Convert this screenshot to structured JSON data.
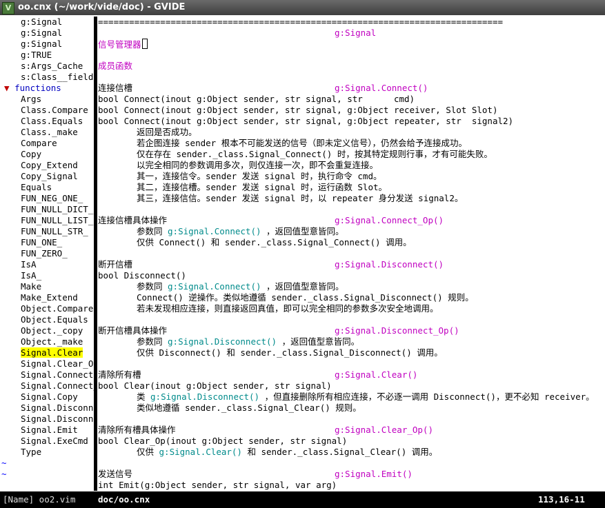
{
  "window": {
    "title": "oo.cnx (~/work/vide/doc) - GVIDE",
    "icon": "vim-icon"
  },
  "tree": {
    "top_items": [
      "g:Signal",
      "g:Signal",
      "g:Signal",
      "g:TRUE",
      "s:Args_Cache",
      "s:Class__field"
    ],
    "folder": {
      "arrow": "▼",
      "label": "functions"
    },
    "items": [
      "Args",
      "Class.Compare",
      "Class.Equals",
      "Class._make",
      "Compare",
      "Copy",
      "Copy_Extend",
      "Copy_Signal",
      "Equals",
      "FUN_NEG_ONE_",
      "FUN_NULL_DICT_",
      "FUN_NULL_LIST_",
      "FUN_NULL_STR_",
      "FUN_ONE_",
      "FUN_ZERO_",
      "IsA",
      "IsA_",
      "Make",
      "Make_Extend",
      "Object.Compare",
      "Object.Equals",
      "Object._copy",
      "Object._make",
      "Signal.Clear",
      "Signal.Clear_Op",
      "Signal.Connect",
      "Signal.Connect_",
      "Signal.Copy",
      "Signal.Disconne",
      "Signal.Disconne",
      "Signal.Emit",
      "Signal.ExeCmd",
      "Type"
    ],
    "selected": "Signal.Clear",
    "tildes": [
      "~",
      "~"
    ]
  },
  "doc": {
    "rule": "==============================================================================",
    "signal_tag": "g:Signal",
    "title": "信号管理器",
    "members": "成员函数",
    "sections": [
      {
        "heading": "连接信槽",
        "tag": "g:Signal.Connect()",
        "code": [
          "bool Connect(inout g:Object sender, str signal, str      cmd)",
          "bool Connect(inout g:Object sender, str signal, g:Object receiver, Slot Slot)",
          "bool Connect(inout g:Object sender, str signal, g:Object repeater, str  signal2)"
        ],
        "desc": [
          "返回是否成功。",
          "若企图连接 sender 根本不可能发送的信号（即未定义信号），仍然会给予连接成功。",
          "仅在存在 sender._class.Signal_Connect() 时，按其特定规则行事，才有可能失败。",
          "以完全相同的参数调用多次，则仅连接一次，即不会重复连接。",
          "其一，连接信令。sender 发送 signal 时，执行命令 cmd。",
          "其二，连接信槽。sender 发送 signal 时，运行函数 Slot。",
          "其三，连接信信。sender 发送 signal 时，以 repeater 身分发送 signal2。"
        ]
      },
      {
        "heading": "连接信槽具体操作",
        "tag": "g:Signal.Connect_Op()",
        "l1": {
          "pre": "参数同 ",
          "link": "g:Signal.Connect()",
          "post": " ，返回值型意皆同。"
        },
        "l2": "仅供 Connect() 和 sender._class.Signal_Connect() 调用。"
      },
      {
        "heading": "断开信槽",
        "tag": "g:Signal.Disconnect()",
        "code": "bool Disconnect()",
        "l1": {
          "pre": "参数同 ",
          "link": "g:Signal.Connect()",
          "post": " ，返回值型意皆同。"
        },
        "l2": "Connect() 逆操作。类似地遵循 sender._class.Signal_Disconnect() 规则。",
        "l3": "若未发现相应连接，则直接返回真值，即可以完全相同的参数多次安全地调用。"
      },
      {
        "heading": "断开信槽具体操作",
        "tag": "g:Signal.Disconnect_Op()",
        "l1": {
          "pre": "参数同 ",
          "link": "g:Signal.Disconnect()",
          "post": " ，返回值型意皆同。"
        },
        "l2": "仅供 Disconnect() 和 sender._class.Signal_Disconnect() 调用。"
      },
      {
        "heading": "清除所有槽",
        "tag": "g:Signal.Clear()",
        "code": "bool Clear(inout g:Object sender, str signal)",
        "l1": {
          "pre": "类 ",
          "link": "g:Signal.Disconnect()",
          "post": " ，但直接删除所有相应连接，不必逐一调用 Disconnect()，更不必知 receiver。"
        },
        "l2": "类似地遵循 sender._class.Signal_Clear() 规则。"
      },
      {
        "heading": "清除所有槽具体操作",
        "tag": "g:Signal.Clear_Op()",
        "code": "bool Clear_Op(inout g:Object sender, str signal)",
        "l1": {
          "pre": "仅供 ",
          "link": "g:Signal.Clear()",
          "post": " 和 sender._class.Signal_Clear() 调用。"
        }
      },
      {
        "heading": "发送信号",
        "tag": "g:Signal.Emit()",
        "code": "int Emit(g:Object sender, str signal, var arg)"
      }
    ]
  },
  "status": {
    "left": "[Name] oo2.vim",
    "file": "doc/oo.cnx",
    "position": "113,16-11"
  }
}
